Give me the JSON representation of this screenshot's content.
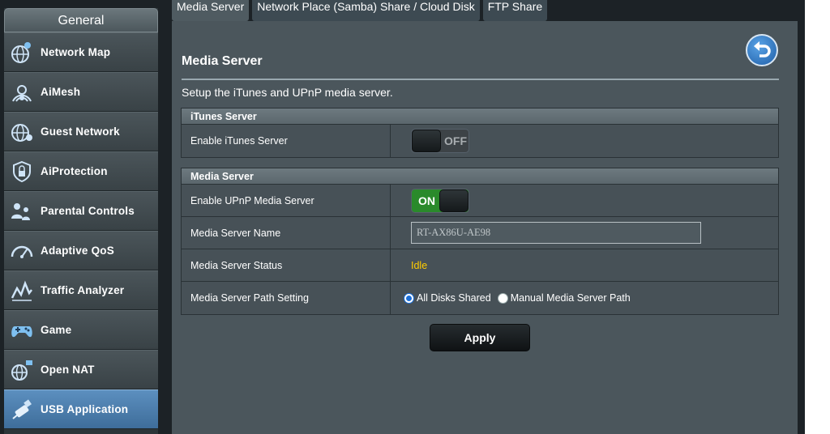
{
  "sidebar": {
    "header": "General",
    "items": [
      {
        "label": "Network Map",
        "icon": "network-map-icon"
      },
      {
        "label": "AiMesh",
        "icon": "aimesh-icon"
      },
      {
        "label": "Guest Network",
        "icon": "guest-network-icon"
      },
      {
        "label": "AiProtection",
        "icon": "shield-lock-icon"
      },
      {
        "label": "Parental Controls",
        "icon": "parental-controls-icon"
      },
      {
        "label": "Adaptive QoS",
        "icon": "speedometer-icon"
      },
      {
        "label": "Traffic Analyzer",
        "icon": "traffic-chart-icon"
      },
      {
        "label": "Game",
        "icon": "gamepad-icon"
      },
      {
        "label": "Open NAT",
        "icon": "open-nat-icon"
      },
      {
        "label": "USB Application",
        "icon": "usb-icon"
      }
    ],
    "active_index": 9
  },
  "tabs": [
    {
      "label": "Media Server"
    },
    {
      "label": "Network Place (Samba) Share / Cloud Disk"
    },
    {
      "label": "FTP Share"
    }
  ],
  "main": {
    "title": "Media Server",
    "description": "Setup the iTunes and UPnP media server.",
    "itunes_section": {
      "heading": "iTunes Server",
      "enable_label": "Enable iTunes Server",
      "enable_state": "OFF"
    },
    "media_section": {
      "heading": "Media Server",
      "upnp_label": "Enable UPnP Media Server",
      "upnp_state": "ON",
      "name_label": "Media Server Name",
      "name_value": "RT-AX86U-AE98",
      "status_label": "Media Server Status",
      "status_value": "Idle",
      "path_label": "Media Server Path Setting",
      "path_options": [
        "All Disks Shared",
        "Manual Media Server Path"
      ],
      "path_selected": 0
    },
    "apply_label": "Apply"
  },
  "colors": {
    "active_nav": "#4a7fb0",
    "toggle_on": "#2a8a2b",
    "status_idle": "#ffcc00",
    "back_button": "#2f7fd0"
  }
}
